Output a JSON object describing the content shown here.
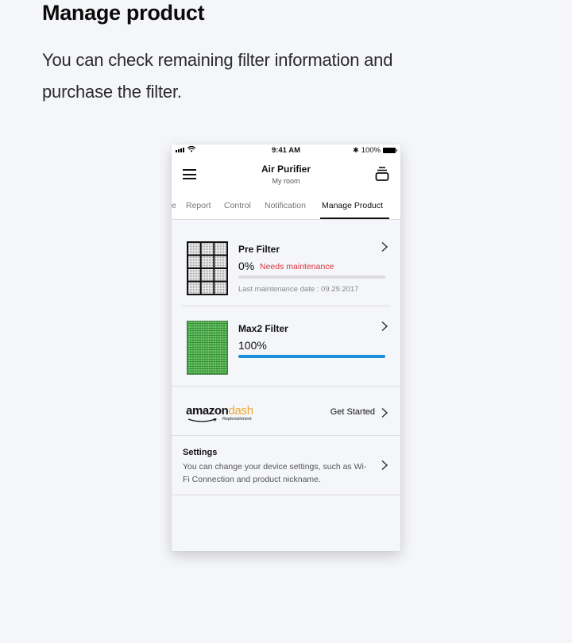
{
  "page": {
    "heading": "Manage product",
    "description": "You can check remaining filter information and purchase the filter."
  },
  "status_bar": {
    "time": "9:41 AM",
    "battery": "100%",
    "icons": [
      "signal-icon",
      "wifi-icon",
      "bluetooth-icon",
      "battery-icon"
    ]
  },
  "app_bar": {
    "title": "Air Purifier",
    "subtitle": "My room",
    "menu_icon": "hamburger-menu-icon",
    "right_icon": "stack-icon"
  },
  "tabs": [
    {
      "label": "e",
      "active": false
    },
    {
      "label": "Report",
      "active": false
    },
    {
      "label": "Control",
      "active": false
    },
    {
      "label": "Notification",
      "active": false
    },
    {
      "label": "Manage Product",
      "active": true
    }
  ],
  "filters": [
    {
      "name": "Pre Filter",
      "percent": "0%",
      "progress": 0,
      "status": "Needs maintenance",
      "last_maintenance": "Last maintenance date : 09.29.2017",
      "image": "pre-filter-grid"
    },
    {
      "name": "Max2 Filter",
      "percent": "100%",
      "progress": 100,
      "status": "",
      "last_maintenance": "",
      "image": "max2-filter-green"
    }
  ],
  "amazon": {
    "brand_word": "amazon",
    "dash_word": "dash",
    "sub": "Replenishment",
    "cta": "Get Started"
  },
  "settings": {
    "title": "Settings",
    "text": "You can change your device settings, such as Wi-Fi Connection and product nickname."
  },
  "colors": {
    "accent_blue": "#1a8fdc",
    "warning_red": "#d9343f",
    "amazon_orange": "#f0a82e",
    "filter_green": "#5cb85c"
  }
}
